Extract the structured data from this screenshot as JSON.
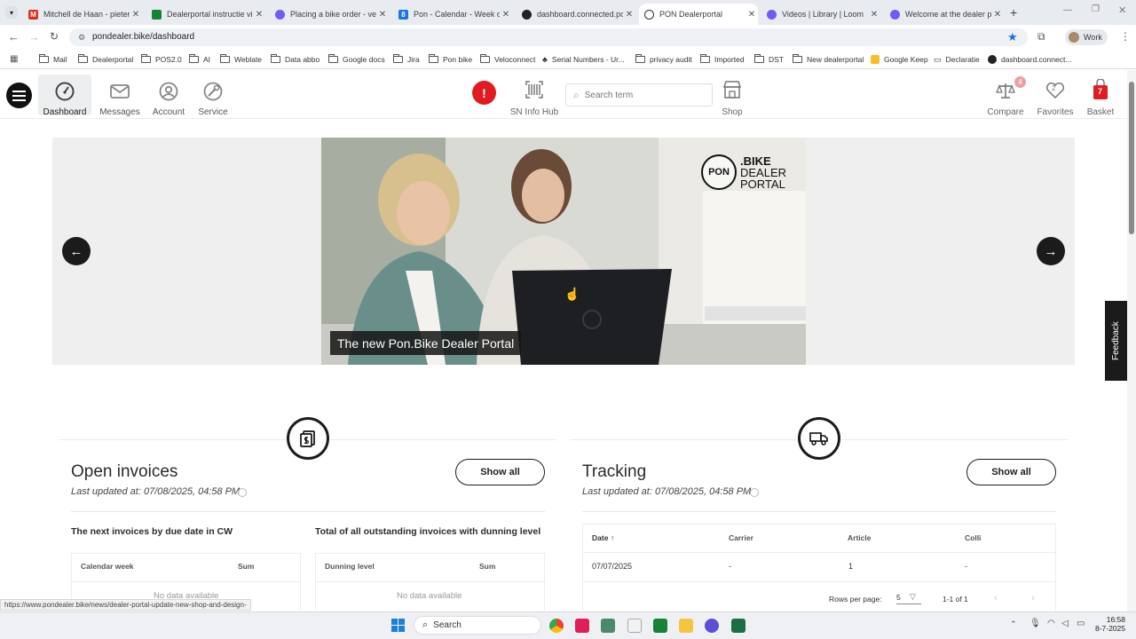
{
  "browser": {
    "tabs": [
      {
        "title": "Mitchell de Haan - pieter",
        "icon": "gmail-icon",
        "color": "#d93025"
      },
      {
        "title": "Dealerportal instructie vi",
        "icon": "sheets-icon",
        "color": "#188038"
      },
      {
        "title": "Placing a bike order - ver",
        "icon": "loom-icon",
        "color": "#6f5cf0"
      },
      {
        "title": "Pon - Calendar - Week of",
        "icon": "calendar-icon",
        "color": "#1a73e8"
      },
      {
        "title": "dashboard.connected.po",
        "icon": "dashboard-icon",
        "color": "#222222"
      },
      {
        "title": "PON Dealerportal",
        "icon": "pon-icon",
        "color": "#333333"
      },
      {
        "title": "Videos | Library | Loom",
        "icon": "loom-icon",
        "color": "#6f5cf0"
      },
      {
        "title": "Welcome at the dealer po",
        "icon": "loom-icon",
        "color": "#6f5cf0"
      }
    ],
    "url": "pondealer.bike/dashboard",
    "profile": "Work",
    "bookmarks": [
      {
        "label": "Mail",
        "icon": "folder-icon"
      },
      {
        "label": "Dealerportal",
        "icon": "folder-icon"
      },
      {
        "label": "POS2.0",
        "icon": "folder-icon"
      },
      {
        "label": "AI",
        "icon": "folder-icon"
      },
      {
        "label": "Weblate",
        "icon": "folder-icon"
      },
      {
        "label": "Data abbo",
        "icon": "folder-icon"
      },
      {
        "label": "Google docs",
        "icon": "folder-icon"
      },
      {
        "label": "Jira",
        "icon": "folder-icon"
      },
      {
        "label": "Pon bike",
        "icon": "folder-icon"
      },
      {
        "label": "Veloconnect",
        "icon": "folder-icon"
      },
      {
        "label": "Serial Numbers - Ur...",
        "icon": "page-icon"
      },
      {
        "label": "privacy audit",
        "icon": "folder-icon"
      },
      {
        "label": "Imported",
        "icon": "folder-icon"
      },
      {
        "label": "DST",
        "icon": "folder-icon"
      },
      {
        "label": "New dealerportal",
        "icon": "folder-icon"
      },
      {
        "label": "Google Keep",
        "icon": "keep-icon"
      },
      {
        "label": "Declaratie",
        "icon": "page-icon"
      },
      {
        "label": "dashboard.connect...",
        "icon": "dashboard-icon"
      }
    ],
    "status_url": "https://www.pondealer.bike/news/dealer-portal-update-new-shop-and-design-"
  },
  "portal": {
    "nav": [
      {
        "label": "Dashboard",
        "icon": "speedometer-icon"
      },
      {
        "label": "Messages",
        "icon": "envelope-icon"
      },
      {
        "label": "Account",
        "icon": "user-icon"
      },
      {
        "label": "Service",
        "icon": "wrench-icon"
      }
    ],
    "alert_symbol": "!",
    "sn_info_hub": "SN Info Hub",
    "search_placeholder": "Search term",
    "shop": "Shop",
    "compare": {
      "label": "Compare",
      "count": "4"
    },
    "favorites": {
      "label": "Favorites",
      "count": "2"
    },
    "basket": {
      "label": "Basket",
      "count": "7"
    },
    "feedback": "Feedback"
  },
  "hero": {
    "caption": "The new Pon.Bike Dealer Portal",
    "logo_pon": "PON",
    "logo_line1": ".BIKE",
    "logo_line2": "DEALER",
    "logo_line3": "PORTAL"
  },
  "invoices": {
    "title": "Open invoices",
    "updated": "Last updated at: 07/08/2025, 04:58 PM",
    "show_all": "Show all",
    "left_heading": "The next invoices by due date in CW",
    "left_cols": [
      "Calendar week",
      "Sum"
    ],
    "left_empty": "No data available",
    "right_heading": "Total of all outstanding invoices with dunning level",
    "right_cols": [
      "Dunning level",
      "Sum"
    ],
    "right_empty": "No data available"
  },
  "tracking": {
    "title": "Tracking",
    "updated": "Last updated at: 07/08/2025, 04:58 PM",
    "show_all": "Show all",
    "columns": [
      "Date",
      "Carrier",
      "Article",
      "Colli"
    ],
    "rows": [
      [
        "07/07/2025",
        "-",
        "1",
        "-"
      ]
    ],
    "rows_per_page_label": "Rows per page:",
    "rows_per_page": "5",
    "range": "1-1 of 1"
  },
  "taskbar": {
    "search": "Search",
    "time": "16:58",
    "date": "8-7-2025"
  }
}
